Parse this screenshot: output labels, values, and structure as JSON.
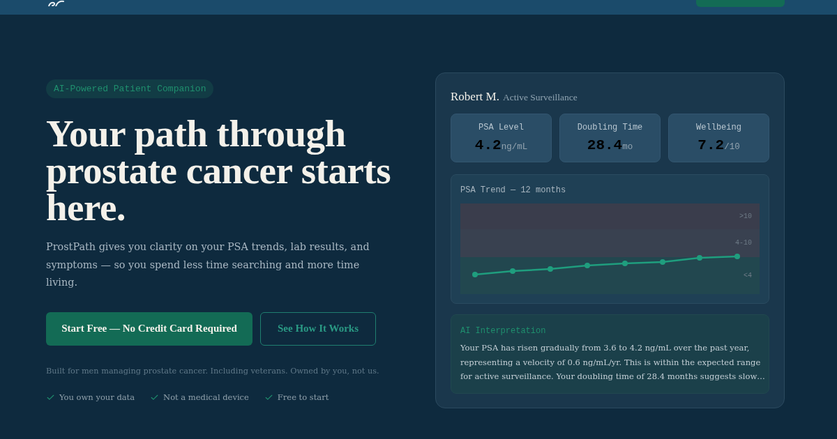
{
  "hero": {
    "badge": "AI-Powered Patient Companion",
    "heading": "Your path through prostate cancer starts here.",
    "description": "ProstPath gives you clarity on your PSA trends, lab results, and symptoms — so you spend less time searching and more time living.",
    "buttons": [
      {
        "label": "Start Free — No Credit Card Required",
        "kind": "primary"
      },
      {
        "label": "See How It Works",
        "kind": "outline"
      }
    ],
    "note": "Built for men managing prostate cancer. Including veterans. Owned by you, not us.",
    "features": [
      "You own your data",
      "Not a medical device",
      "Free to start"
    ]
  },
  "patient_card": {
    "name": "Robert M.",
    "status": "Active Surveillance",
    "stats": [
      {
        "label": "PSA Level",
        "value": "4.2",
        "unit": "ng/mL"
      },
      {
        "label": "Doubling Time",
        "value": "28.4",
        "unit": "mo"
      },
      {
        "label": "Wellbeing",
        "value": "7.2",
        "unit": "/10"
      }
    ],
    "psa_trend": {
      "title": "PSA Trend — 12 months",
      "bands": [
        {
          "label": ">10",
          "color": "#3a3d4c"
        },
        {
          "label": "4-10",
          "color": "#394150"
        },
        {
          "label": "<4",
          "color": "#22474f"
        }
      ]
    },
    "ai_interpretation": {
      "title": "AI Interpretation",
      "text": "Your PSA has risen gradually from 3.6 to 4.2 ng/mL over the past year, representing a velocity of 0.6 ng/mL/yr. This is within the expected range for active surveillance. Your doubling time of 28.4 months suggests slow…"
    }
  }
}
